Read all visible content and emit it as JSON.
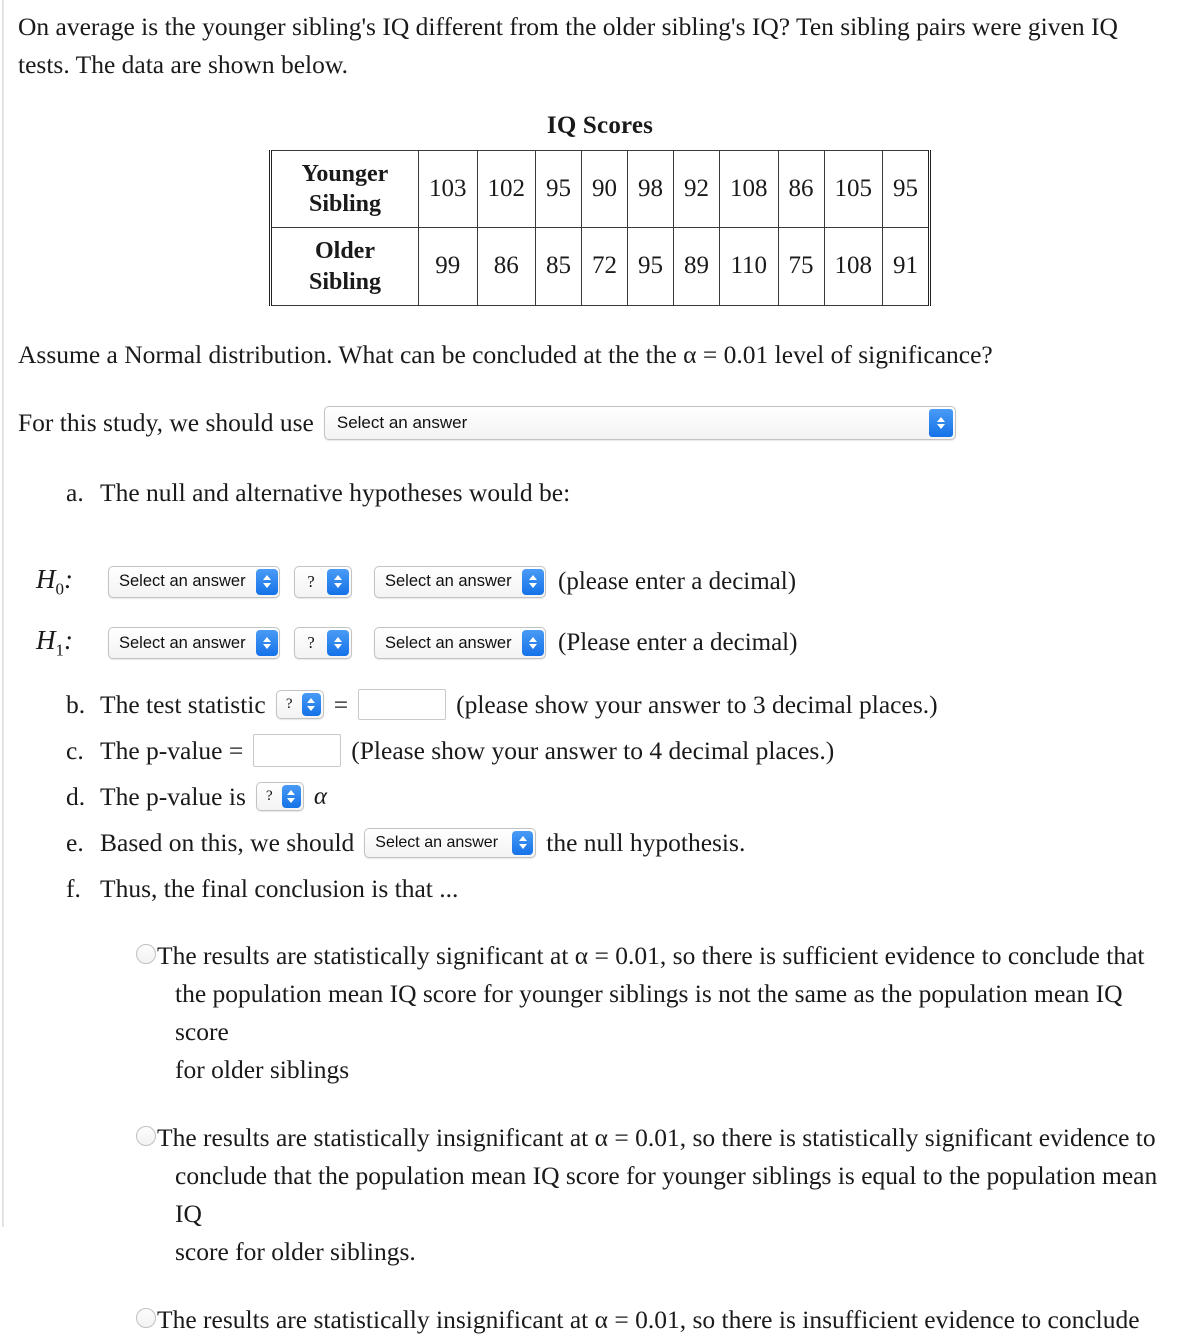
{
  "intro": {
    "text": "On average is the younger sibling's IQ different from the older sibling's IQ? Ten sibling pairs were given IQ tests. The data are shown below."
  },
  "table": {
    "title": "IQ Scores",
    "rows": [
      {
        "label_line1": "Younger",
        "label_line2": "Sibling",
        "values": [
          103,
          102,
          95,
          90,
          98,
          92,
          108,
          86,
          105,
          95
        ]
      },
      {
        "label_line1": "Older",
        "label_line2": "Sibling",
        "values": [
          99,
          86,
          85,
          72,
          95,
          89,
          110,
          75,
          108,
          91
        ]
      }
    ]
  },
  "assume": {
    "text": "Assume a Normal distribution.  What can be concluded at the the α = 0.01 level of significance?"
  },
  "study": {
    "label": "For this study, we should use",
    "select_value": "Select an answer"
  },
  "part_a": {
    "marker": "a.",
    "text": "The null and alternative hypotheses would be:"
  },
  "hypotheses": [
    {
      "label": "H",
      "subscript": "0",
      "colon": ":",
      "select1": "Select an answer",
      "select_op": "?",
      "select2": "Select an answer",
      "note": "(please enter a decimal)"
    },
    {
      "label": "H",
      "subscript": "1",
      "colon": ":",
      "select1": "Select an answer",
      "select_op": "?",
      "select2": "Select an answer",
      "note": "(Please enter a decimal)"
    }
  ],
  "steps": {
    "b": {
      "marker": "b.",
      "text_before": "The test statistic",
      "select_op": "?",
      "equals": "=",
      "input_value": "",
      "text_after": "(please show your answer to 3 decimal places.)"
    },
    "c": {
      "marker": "c.",
      "text_before": "The p-value =",
      "input_value": "",
      "text_after": "(Please show your answer to 4 decimal places.)"
    },
    "d": {
      "marker": "d.",
      "text_before": "The p-value is",
      "select_op": "?",
      "text_after": "α"
    },
    "e": {
      "marker": "e.",
      "text_before": "Based on this, we should",
      "select_value": "Select an answer",
      "text_after": "the null hypothesis."
    },
    "f": {
      "marker": "f.",
      "text": "Thus, the final conclusion is that ..."
    }
  },
  "options": [
    {
      "line1": "The results are statistically significant at α = 0.01, so there is sufficient evidence to conclude that",
      "line2": "the population mean IQ score for younger siblings is not the same as the population mean IQ score",
      "line3": "for older siblings"
    },
    {
      "line1": "The results are statistically insignificant at α = 0.01, so there is statistically significant evidence to",
      "line2": "conclude that the population mean IQ score for younger siblings is equal to the population mean IQ",
      "line3": "score for older siblings."
    },
    {
      "line1": "The results are statistically insignificant at α = 0.01, so there is insufficient evidence to conclude",
      "line2": "",
      "line3": ""
    }
  ],
  "colors": {
    "accent_blue": "#1472e8",
    "text": "#1a1a1a",
    "input_border": "#c9c9c9"
  }
}
